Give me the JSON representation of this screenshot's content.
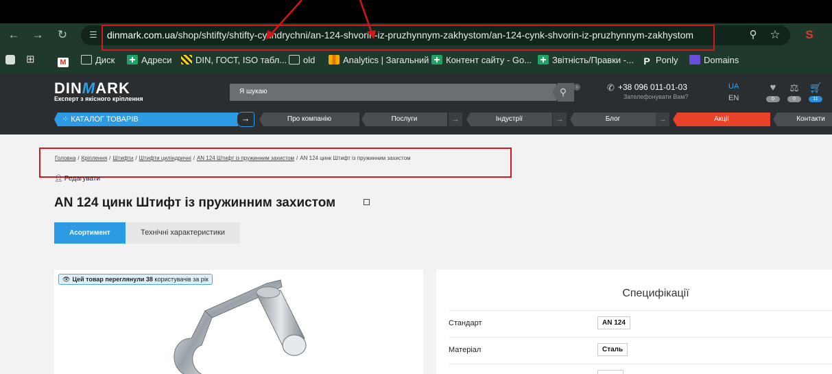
{
  "browser": {
    "url_host": "dinmark.com.ua",
    "url_path": "/shop/shtifty/shtifty-cylindrychni/an-124-shvorin-iz-pruzhynnym-zakhystom/an-124-cynk-shvorin-iz-pruzhynnym-zakhystom",
    "icons": {
      "back": "back-arrow-icon",
      "forward": "forward-arrow-icon",
      "reload": "reload-icon",
      "site_info": "site-settings-icon",
      "zoom": "zoom-icon",
      "star": "bookmark-star-icon",
      "extension": "seo-extension-icon"
    }
  },
  "bookmarks": [
    {
      "label": "",
      "icon": "gmail"
    },
    {
      "label": "Диск",
      "icon": "folder"
    },
    {
      "label": "Адреси",
      "icon": "sheet"
    },
    {
      "label": "DIN, ГОСТ, ISO табл...",
      "icon": "din"
    },
    {
      "label": "old",
      "icon": "folder"
    },
    {
      "label": "Analytics | Загальний",
      "icon": "analytics"
    },
    {
      "label": "Контент сайту - Go...",
      "icon": "sheet"
    },
    {
      "label": "Звітність/Правки -...",
      "icon": "sheet"
    },
    {
      "label": "Ponly",
      "icon": "p"
    },
    {
      "label": "Domains",
      "icon": "domains"
    }
  ],
  "site": {
    "logo_left": "DIN",
    "logo_m": "M",
    "logo_right": "ARK",
    "tagline": "Експерт з якісного кріплення",
    "search_placeholder": "Я шукаю",
    "phone": "+38 096 011-01-03",
    "callback": "Зателефонувати Вам?",
    "lang_active": "UA",
    "lang_other": "EN",
    "wishlist_count": "0",
    "compare_count": "0",
    "cart_count": "11"
  },
  "nav": {
    "catalog": "КАТАЛОГ ТОВАРІВ",
    "items": [
      "Про компанію",
      "Послуги",
      "Індустрії",
      "Блог",
      "Акції",
      "Контакти"
    ]
  },
  "breadcrumb": [
    "Головна",
    "Кріплення",
    "Штифти",
    "Штифти циліндричні",
    "AN 124 Штифт із пружинним захистом",
    "AN 124 цинк Штифт із пружинним захистом"
  ],
  "edit_label": "Редагувати",
  "page_title": "AN 124 цинк Штифт із пружинним захистом",
  "tabs": [
    "Асортимент",
    "Технічні характеристики"
  ],
  "viewed": {
    "prefix": "Цей товар переглянули",
    "count": "38",
    "suffix": "користувачів за рік"
  },
  "specs": {
    "title": "Специфікації",
    "rows": [
      {
        "label": "Стандарт",
        "value": "AN 124"
      },
      {
        "label": "Матеріал",
        "value": "Сталь"
      },
      {
        "label": "",
        "value": ""
      }
    ]
  },
  "colors": {
    "accent": "#2d9be3",
    "header_bg": "#2b2e31",
    "promo": "#e8432a",
    "annotation": "#d8151d"
  }
}
